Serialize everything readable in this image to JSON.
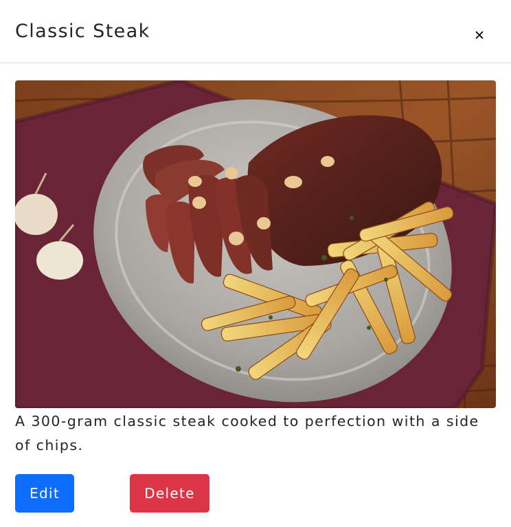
{
  "modal": {
    "title": "Classic Steak",
    "close_label": "×"
  },
  "item": {
    "image_alt": "Classic Steak",
    "description": "A 300-gram classic steak cooked to perfection with a side of chips."
  },
  "actions": {
    "edit_label": "Edit",
    "delete_label": "Delete"
  },
  "colors": {
    "edit_button": "#0d6efd",
    "delete_button": "#dc3545",
    "text": "#212529",
    "divider": "#dee2e6"
  },
  "icons": {
    "close": "close-icon"
  }
}
